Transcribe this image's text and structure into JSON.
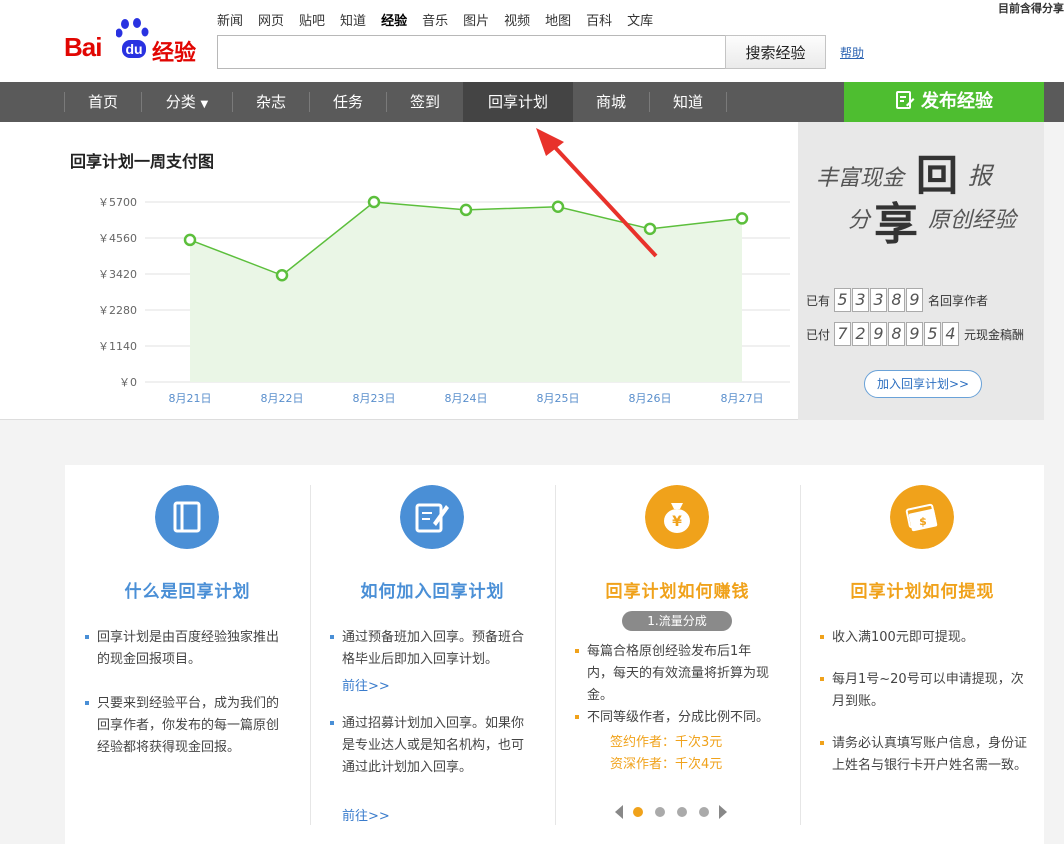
{
  "top_right_text": "目前含得分享",
  "logo": {
    "bai": "Bai",
    "du": "du",
    "jy": "经验"
  },
  "top_nav": [
    "新闻",
    "网页",
    "贴吧",
    "知道",
    "经验",
    "音乐",
    "图片",
    "视频",
    "地图",
    "百科",
    "文库"
  ],
  "top_nav_active": "经验",
  "search": {
    "placeholder": "",
    "button": "搜索经验",
    "help": "帮助"
  },
  "main_nav": [
    "首页",
    "分类",
    "杂志",
    "任务",
    "签到",
    "回享计划",
    "商城",
    "知道"
  ],
  "main_nav_active": "回享计划",
  "publish_button": "发布经验",
  "chart_title": "回享计划一周支付图",
  "chart_data": {
    "type": "area",
    "title": "回享计划一周支付图",
    "categories": [
      "8月21日",
      "8月22日",
      "8月23日",
      "8月24日",
      "8月25日",
      "8月26日",
      "8月27日"
    ],
    "values": [
      4500,
      3380,
      5700,
      5450,
      5550,
      4850,
      5180
    ],
    "y_ticks": [
      "￥0",
      "￥1140",
      "￥2280",
      "￥3420",
      "￥4560",
      "￥5700"
    ],
    "ylim": [
      0,
      5700
    ],
    "grid": true,
    "colors": {
      "line": "#5cbf3c",
      "fill": "#eaf6e6",
      "label": "#5a8fcc"
    }
  },
  "promo": {
    "art_line1": "丰富现金",
    "art_big1": "回",
    "art_big1b": "报",
    "art_line2a": "分",
    "art_big2": "享",
    "art_line2b": "原创经验",
    "authors_prefix": "已有",
    "authors_digits": [
      "5",
      "3",
      "3",
      "8",
      "9"
    ],
    "authors_suffix": "名回享作者",
    "paid_prefix": "已付",
    "paid_digits": [
      "7",
      "2",
      "9",
      "8",
      "9",
      "5",
      "4"
    ],
    "paid_suffix": "元现金稿酬",
    "join_button": "加入回享计划>>"
  },
  "cards": [
    {
      "title": "什么是回享计划",
      "color": "#4a8fd6",
      "bullets": [
        "回享计划是由百度经验独家推出的现金回报项目。",
        "只要来到经验平台，成为我们的回享作者，你发布的每一篇原创经验都将获得现金回报。"
      ]
    },
    {
      "title": "如何加入回享计划",
      "color": "#4a8fd6",
      "bullets": [
        "通过预备班加入回享。预备班合格毕业后即加入回享计划。",
        "通过招募计划加入回享。如果你是专业达人或是知名机构，也可通过此计划加入回享。"
      ],
      "links": [
        "前往>>",
        "前往>>"
      ]
    },
    {
      "title": "回享计划如何赚钱",
      "color": "#f0a21b",
      "pill": "1.流量分成",
      "bullets": [
        "每篇合格原创经验发布后1年内，每天的有效流量将折算为现金。",
        "不同等级作者，分成比例不同。"
      ],
      "rates": [
        "签约作者：千次3元",
        "资深作者：千次4元"
      ]
    },
    {
      "title": "回享计划如何提现",
      "color": "#f0a21b",
      "bullets": [
        "收入满100元即可提现。",
        "每月1号~20号可以申请提现，次月到账。",
        "请务必认真填写账户信息，身份证上姓名与银行卡开户姓名需一致。"
      ]
    }
  ]
}
